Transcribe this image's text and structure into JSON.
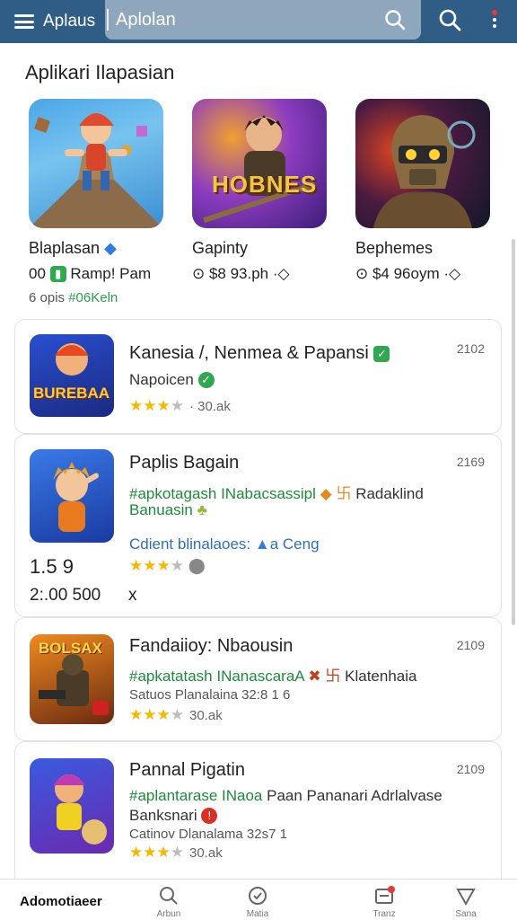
{
  "header": {
    "brand": "Aplaus",
    "search_value": "Aplolan",
    "search_placeholder": ""
  },
  "featured_section": {
    "title": "Aplikari Ilapasian",
    "items": [
      {
        "name": "Blaplasan",
        "meta": "00 ",
        "meta_rest": "Ramp! Pam",
        "sub_a": "6 opis ",
        "sub_b": "#06Keln"
      },
      {
        "name": "Gapinty",
        "meta": "⊙ $8 93.ph",
        "meta_rest": "·◇"
      },
      {
        "name": "Bephemes",
        "meta": "⊙ $4 96oym",
        "meta_rest": "·◇"
      }
    ],
    "art_text_2": "HOBNES"
  },
  "list": [
    {
      "title": "Kanesia  /, Nenmea & Papansi",
      "number": "2102",
      "line1": "Napoicen",
      "rating_count": "30.ak",
      "icon_text": "BUREBAA"
    },
    {
      "title": "Paplis Bagain",
      "number": "2169",
      "line1_green": "#apkotagash INabacsassipl",
      "line1_dark": "Radaklind",
      "line2_green": "Banuasin",
      "line3_blue": "Cdient blinalaoes:",
      "line3_tag": "a Ceng",
      "left_num_1": "1.5  9",
      "left_num_2": "2:.00  500",
      "x_mark": "x"
    },
    {
      "title": "Fandaiioy: Nbaousin",
      "number": "2109",
      "line1_green": "#apkatatash INanascaraA",
      "line1_dark": "Klatenhaia",
      "line2": "Satuos Planalaina 32:8 1 6",
      "rating_count": "30.ak",
      "icon_text": "BOLSAX"
    },
    {
      "title": "Pannal Pigatin",
      "number": "2109",
      "line1_green": "#aplantarase INaoa",
      "line1_dark": "Paan Pananari Adrlalvase",
      "line2": "Banksnari",
      "line3": "Catinov Dlanalama 32s7 1",
      "rating_count": "30.ak"
    }
  ],
  "bottom_nav": {
    "home": "Adomotiaeer",
    "search": "Arbun",
    "updates": "Matia",
    "inbox": "Tranz",
    "saved": "Sana"
  },
  "colors": {
    "header": "#2f5d86",
    "accent_green": "#1f8a3c",
    "star": "#f5b800"
  }
}
